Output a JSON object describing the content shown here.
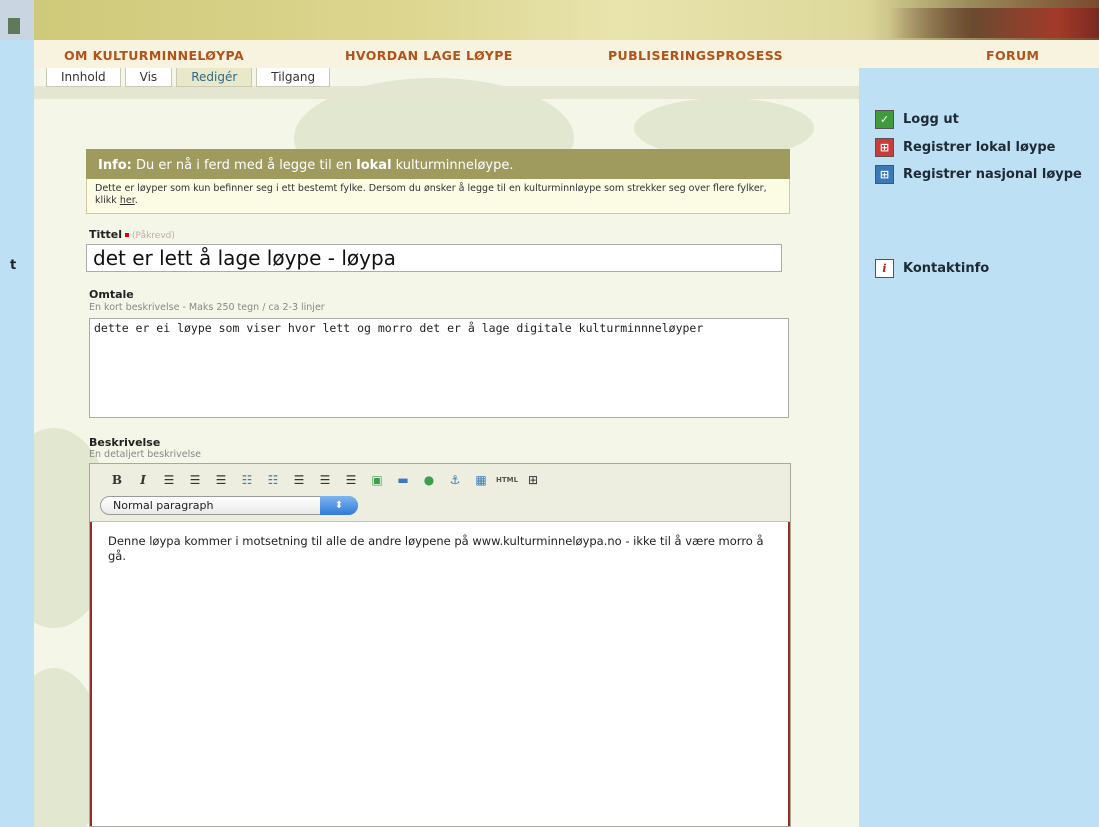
{
  "nav": {
    "items": [
      "OM KULTURMINNELØYPA",
      "HVORDAN LAGE LØYPE",
      "PUBLISERINGSPROSESS",
      "FORUM"
    ]
  },
  "tabs": [
    {
      "label": "Innhold",
      "active": false
    },
    {
      "label": "Vis",
      "active": false
    },
    {
      "label": "Redigér",
      "active": true
    },
    {
      "label": "Tilgang",
      "active": false
    }
  ],
  "info": {
    "prefix": "Info:",
    "text_before": "Du er nå i ferd med å legge til en",
    "bold": "lokal",
    "text_after": "kulturminneløype.",
    "body": "Dette er løyper som kun befinner seg i ett bestemt fylke. Dersom du ønsker å legge til en kulturminnløype som strekker seg over flere fylker, klikk",
    "link": "her",
    "end": "."
  },
  "form": {
    "title_label": "Tittel",
    "title_required": "(Påkrevd)",
    "title_value": "det er lett å lage løype - løypa",
    "omtale_label": "Omtale",
    "omtale_help": "En kort beskrivelse - Maks 250 tegn / ca 2-3 linjer",
    "omtale_value": "dette er ei løype som viser hvor lett og morro det er å lage digitale kulturminnneløyper",
    "beskrivelse_label": "Beskrivelse",
    "beskrivelse_help": "En detaljert beskrivelse",
    "format_select": "Normal paragraph",
    "editor_text": "Denne løypa kommer i motsetning til alle de andre løypene på www.kulturminneløypa.no - ikke til å være morro å gå."
  },
  "toolbar": {
    "bold": "B",
    "italic": "I",
    "html": "HTML"
  },
  "sidebar": {
    "logout": "Logg ut",
    "register_local": "Registrer lokal løype",
    "register_national": "Registrer nasjonal løype",
    "contact": "Kontaktinfo"
  },
  "left_stub": "t"
}
